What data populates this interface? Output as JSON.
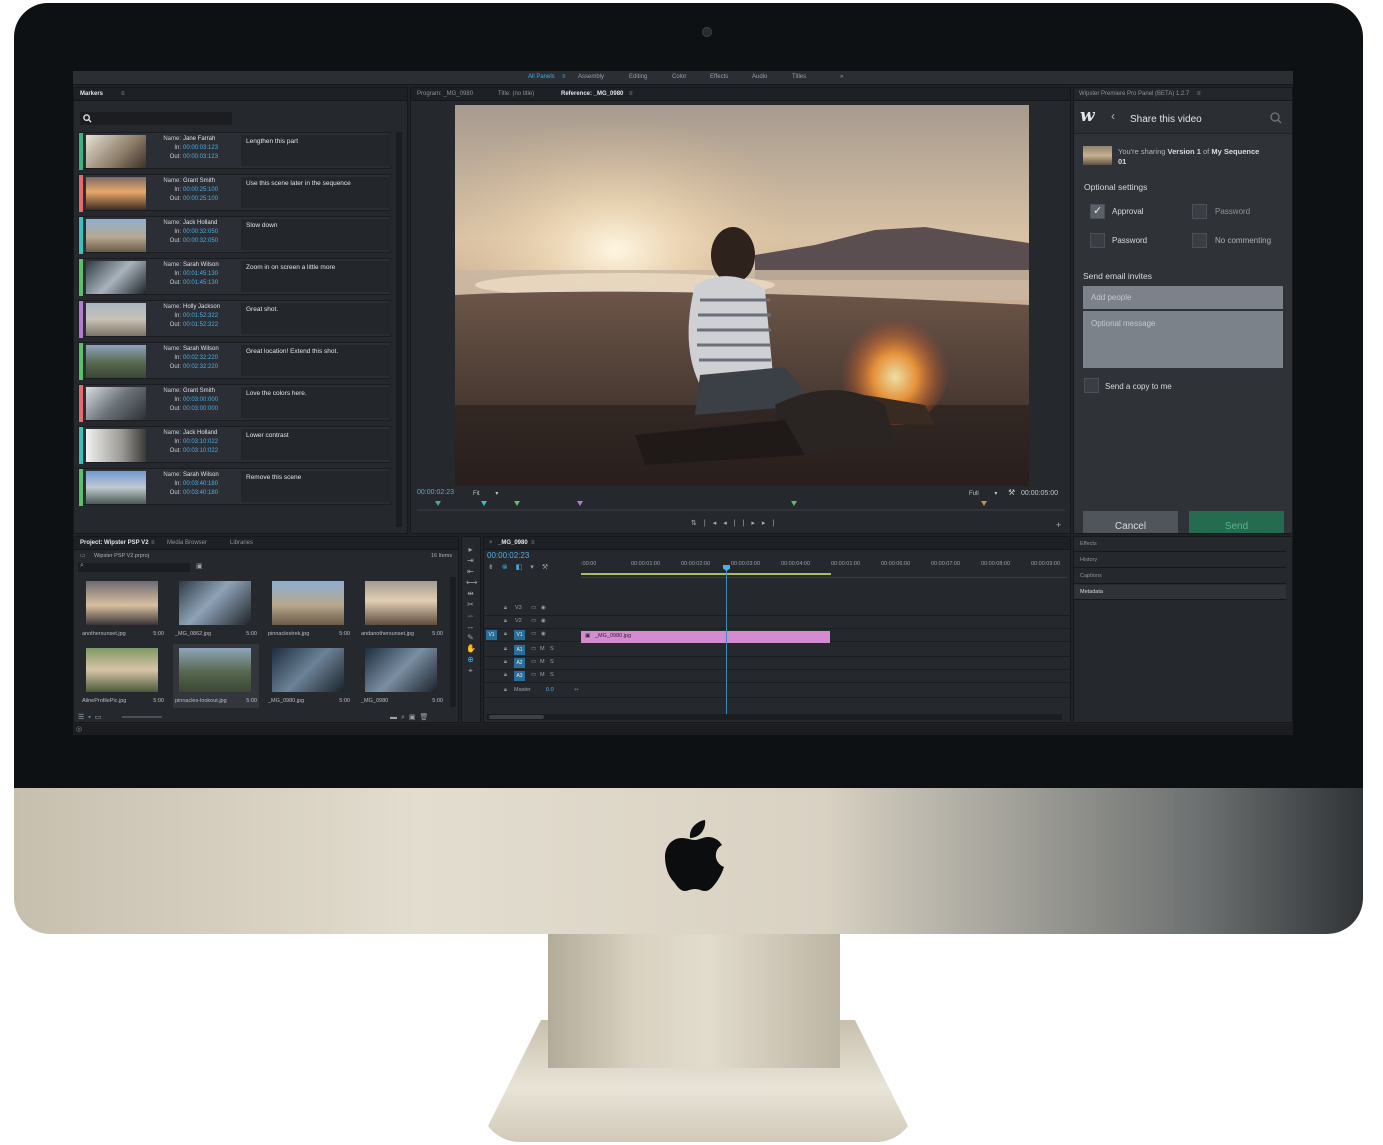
{
  "workspace": {
    "tabs": [
      "All Panels",
      "Assembly",
      "Editing",
      "Color",
      "Effects",
      "Audio",
      "Titles"
    ],
    "more": "»"
  },
  "markers_panel": {
    "tab": "Markers",
    "markers": [
      {
        "name": "Jane Farrah",
        "in": "00:00:03:123",
        "out": "00:00:03:123",
        "note": "Lengthen this part",
        "color": "#3fb37f"
      },
      {
        "name": "Grant Smith",
        "in": "00:00:25:100",
        "out": "00:00:25:100",
        "note": "Use this scene later in the sequence",
        "color": "#e86a6a"
      },
      {
        "name": "Jack Holland",
        "in": "00:00:32:050",
        "out": "00:00:32:050",
        "note": "Slow down",
        "color": "#3bbfbf"
      },
      {
        "name": "Sarah Wilson",
        "in": "00:01:45:130",
        "out": "00:01:45:130",
        "note": "Zoom in on screen a little more",
        "color": "#5bc06a"
      },
      {
        "name": "Holly Jackson",
        "in": "00:01:52:322",
        "out": "00:01:52:322",
        "note": "Great shot.",
        "color": "#b67ad6"
      },
      {
        "name": "Sarah Wilson",
        "in": "00:02:32:220",
        "out": "00:02:32:220",
        "note": "Great location! Extend this shot.",
        "color": "#5bc06a"
      },
      {
        "name": "Grant Smith",
        "in": "00:03:00:000",
        "out": "00:03:00:000",
        "note": "Love the colors here.",
        "color": "#e86a6a"
      },
      {
        "name": "Jack Holland",
        "in": "00:03:10:022",
        "out": "00:03:10:022",
        "note": "Lower contrast",
        "color": "#3bbfbf"
      },
      {
        "name": "Sarah Wilson",
        "in": "00:03:40:180",
        "out": "00:03:40:180",
        "note": "Remove this scene",
        "color": "#5bc06a"
      }
    ],
    "labels": {
      "name": "Name:",
      "in": "In:",
      "out": "Out:"
    }
  },
  "monitor": {
    "tabs": [
      "Program: _MG_0980",
      "Title: (no title)",
      "Reference: _MG_0980"
    ],
    "timecode": "00:00:02:23",
    "fit": "Fit",
    "quality": "Full",
    "duration": "00:00:05:00"
  },
  "wipster": {
    "panel_title": "Wipster Premiere Pro Panel (BETA) 1.2.7",
    "heading": "Share this video",
    "sharing_prefix": "You're sharing",
    "sharing_version": "Version 1",
    "sharing_of": "of",
    "sharing_sequence": "My Sequence",
    "sharing_sequence_cont": "01",
    "optional_settings": "Optional settings",
    "options": {
      "approval": "Approval",
      "password_top": "Password",
      "password": "Password",
      "no_commenting": "No commenting"
    },
    "send_invites": "Send email invites",
    "add_people_placeholder": "Add people",
    "message_placeholder": "Optional message",
    "send_copy": "Send a copy to me",
    "cancel": "Cancel",
    "send": "Send"
  },
  "right_stack": [
    "Effects",
    "History",
    "Captions",
    "Metadata"
  ],
  "project": {
    "tabs": [
      "Project: Wipster PSP V2",
      "Media Browser",
      "Libraries"
    ],
    "file": "Wipster PSP V2.prproj",
    "count": "16 Items",
    "items": [
      {
        "name": "anothersunset.jpg",
        "dur": "5:00"
      },
      {
        "name": "_MG_0862.jpg",
        "dur": "5:00"
      },
      {
        "name": "pinnaclestrek.jpg",
        "dur": "5:00"
      },
      {
        "name": "andanothersunset.jpg",
        "dur": "5:00"
      },
      {
        "name": "AlineProfilePic.jpg",
        "dur": "5:00"
      },
      {
        "name": "pinnacles-lookout.jpg",
        "dur": "5:00"
      },
      {
        "name": "_MG_0980.jpg",
        "dur": "5:00"
      },
      {
        "name": "_MG_0980",
        "dur": "5:00"
      }
    ]
  },
  "timeline": {
    "tab": "_MG_0980",
    "timecode": "00:00:02:23",
    "ticks": [
      ":00:00",
      "00:00:01:00",
      "00:00:02:00",
      "00:00:03:00",
      "00:00:04:00",
      "00:00:01:00",
      "00:00:06:00",
      "00:00:07:00",
      "00:00:08:00",
      "00:00:09:00"
    ],
    "tracks": [
      "V3",
      "V2",
      "V1",
      "A1",
      "A2",
      "A3"
    ],
    "source_v": "V1",
    "master": "Master",
    "master_val": "0.0",
    "clip": "_MG_0980.jpg",
    "mute": "M",
    "solo": "S"
  }
}
